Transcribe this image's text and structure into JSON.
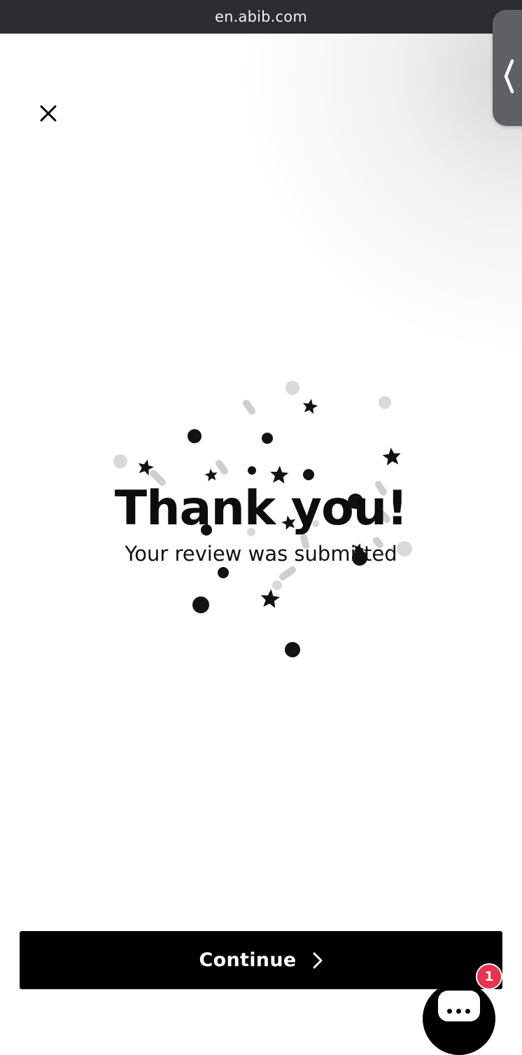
{
  "browser": {
    "url": "en.abib.com"
  },
  "icons": {
    "close": "close-icon",
    "side_tab": "chevron-left-icon",
    "continue": "chevron-right-icon",
    "chat": "chat-bubble-icon"
  },
  "confirmation": {
    "title": "Thank you!",
    "subtitle": "Your review was submitted"
  },
  "actions": {
    "continue_label": "Continue"
  },
  "chat": {
    "badge_count": "1"
  },
  "colors": {
    "url_bar": "#2c2d30",
    "button": "#000000",
    "badge": "#e8324f",
    "confetti_dark": "#111111",
    "confetti_light": "#d8d8d8"
  }
}
